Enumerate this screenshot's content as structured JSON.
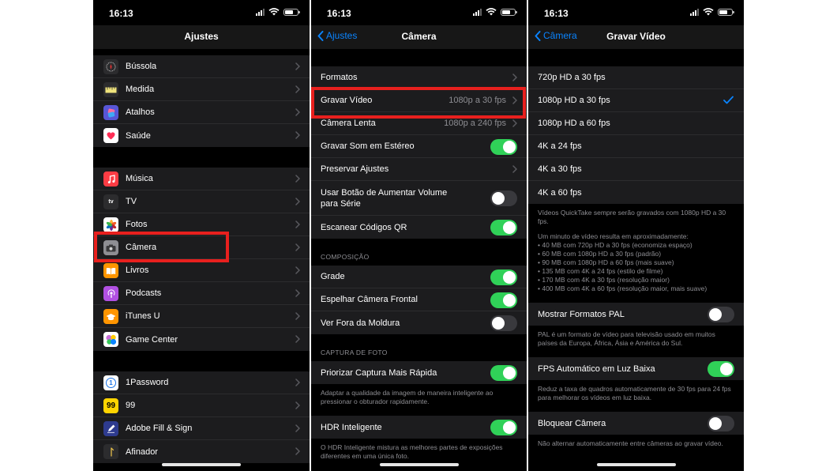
{
  "status_time": "16:13",
  "screen1": {
    "title": "Ajustes",
    "group1": [
      {
        "label": "Bússola",
        "icon": "compass-icon",
        "color": "#2c2c2e"
      },
      {
        "label": "Medida",
        "icon": "ruler-icon",
        "color": "#2c2c2e"
      },
      {
        "label": "Atalhos",
        "icon": "shortcuts-icon",
        "color": "#5856d6"
      },
      {
        "label": "Saúde",
        "icon": "heart-icon",
        "color": "#ffffff"
      }
    ],
    "group2": [
      {
        "label": "Música",
        "icon": "music-note-icon",
        "color": "#fc3c44"
      },
      {
        "label": "TV",
        "icon": "appletv-icon",
        "color": "#2c2c2e"
      },
      {
        "label": "Fotos",
        "icon": "photos-flower-icon",
        "color": "#ffffff"
      },
      {
        "label": "Câmera",
        "icon": "camera-icon",
        "color": "#8e8e93"
      },
      {
        "label": "Livros",
        "icon": "book-icon",
        "color": "#ff9500"
      },
      {
        "label": "Podcasts",
        "icon": "podcast-icon",
        "color": "#b150e2"
      },
      {
        "label": "iTunes U",
        "icon": "graduation-cap-icon",
        "color": "#ff9500"
      },
      {
        "label": "Game Center",
        "icon": "game-center-icon",
        "color": "#ffffff"
      }
    ],
    "group3": [
      {
        "label": "1Password",
        "icon": "1password-icon",
        "color": "#ffffff"
      },
      {
        "label": "99",
        "icon": "99-icon",
        "color": "#ffd400"
      },
      {
        "label": "Adobe Fill & Sign",
        "icon": "pen-icon",
        "color": "#2e3b8f"
      },
      {
        "label": "Afinador",
        "icon": "tuner-icon",
        "color": "#2c2c2e"
      }
    ],
    "icon_text": {
      "1password": "1",
      "99": "99",
      "tv": "tv"
    }
  },
  "screen2": {
    "back": "Ajustes",
    "title": "Câmera",
    "group1": [
      {
        "label": "Formatos",
        "value": "",
        "type": "chevron"
      },
      {
        "label": "Gravar Vídeo",
        "value": "1080p a 30 fps",
        "type": "chevron"
      },
      {
        "label": "Câmera Lenta",
        "value": "1080p a 240 fps",
        "type": "chevron"
      },
      {
        "label": "Gravar Som em Estéreo",
        "type": "toggle",
        "on": true
      },
      {
        "label": "Preservar Ajustes",
        "value": "",
        "type": "chevron"
      },
      {
        "label": "Usar Botão de Aumentar Volume para Série",
        "type": "toggle",
        "on": false
      },
      {
        "label": "Escanear Códigos QR",
        "type": "toggle",
        "on": true
      }
    ],
    "composicao_header": "COMPOSIÇÃO",
    "composicao": [
      {
        "label": "Grade",
        "on": true
      },
      {
        "label": "Espelhar Câmera Frontal",
        "on": true
      },
      {
        "label": "Ver Fora da Moldura",
        "on": false
      }
    ],
    "captura_header": "CAPTURA DE FOTO",
    "captura": {
      "label": "Priorizar Captura Mais Rápida",
      "on": true
    },
    "captura_footer": "Adaptar a qualidade da imagem de maneira inteligente ao pressionar o obturador rapidamente.",
    "hdr": {
      "label": "HDR Inteligente",
      "on": true
    },
    "hdr_footer": "O HDR Inteligente mistura as melhores partes de exposições diferentes em uma única foto."
  },
  "screen3": {
    "back": "Câmera",
    "title": "Gravar Vídeo",
    "options": [
      {
        "label": "720p HD a 30 fps",
        "selected": false
      },
      {
        "label": "1080p HD a 30 fps",
        "selected": true
      },
      {
        "label": "1080p HD a 60 fps",
        "selected": false
      },
      {
        "label": "4K a 24 fps",
        "selected": false
      },
      {
        "label": "4K a 30 fps",
        "selected": false
      },
      {
        "label": "4K a 60 fps",
        "selected": false
      }
    ],
    "footer1": "Vídeos QuickTake sempre serão gravados com 1080p HD a 30 fps.",
    "footer2": "Um minuto de vídeo resulta em aproximadamente:",
    "footer_list": [
      "• 40 MB com 720p HD a 30 fps (economiza espaço)",
      "• 60 MB com 1080p HD a 30 fps (padrão)",
      "• 90 MB com 1080p HD a 60 fps (mais suave)",
      "• 135 MB com 4K a 24 fps (estilo de filme)",
      "• 170 MB com 4K a 30 fps (resolução maior)",
      "• 400 MB com 4K a 60 fps (resolução maior, mais suave)"
    ],
    "pal": {
      "label": "Mostrar Formatos PAL",
      "on": false
    },
    "pal_footer": "PAL é um formato de vídeo para televisão usado em muitos países da Europa, África, Ásia e América do Sul.",
    "fps": {
      "label": "FPS Automático em Luz Baixa",
      "on": true
    },
    "fps_footer": "Reduz a taxa de quadros automaticamente de 30 fps para 24 fps para melhorar os vídeos em luz baixa.",
    "lock": {
      "label": "Bloquear Câmera",
      "on": false
    },
    "lock_footer": "Não alternar automaticamente entre câmeras ao gravar vídeo."
  },
  "colors": {
    "accent": "#0a84ff",
    "toggle_on": "#30d158",
    "highlight": "#e8201e"
  }
}
